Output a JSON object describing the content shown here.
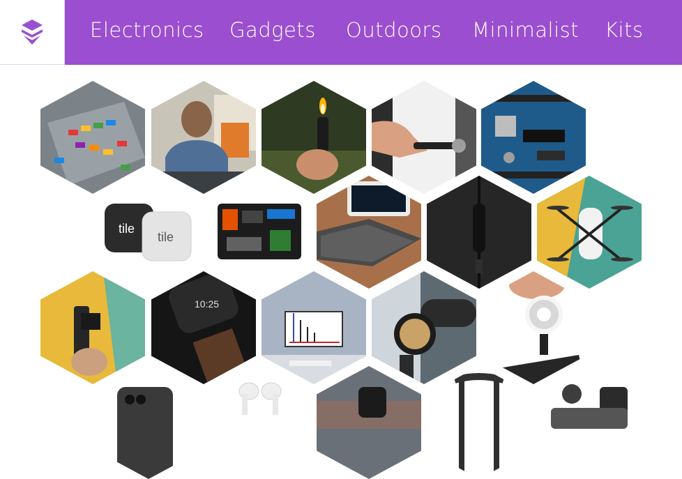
{
  "header": {
    "logo_icon": "layered-stack-icon",
    "brand_color": "#9b4fd0",
    "nav": [
      {
        "label": "Electronics"
      },
      {
        "label": "Gadgets"
      },
      {
        "label": "Outdoors"
      },
      {
        "label": "Minimalist"
      },
      {
        "label": "Kits"
      }
    ]
  },
  "gallery": {
    "tile_text": {
      "tile_front": "tile",
      "tile_back": "tile",
      "watch_time": "10:25"
    },
    "tiles": [
      {
        "name": "lego-building-plate"
      },
      {
        "name": "bus-passenger-headphones"
      },
      {
        "name": "mini-lighter"
      },
      {
        "name": "keychain-flashlight"
      },
      {
        "name": "arduino-board"
      },
      {
        "name": "tile-trackers"
      },
      {
        "name": "cable-organizer"
      },
      {
        "name": "foldable-keyboard"
      },
      {
        "name": "braided-cable"
      },
      {
        "name": "mini-drone"
      },
      {
        "name": "pocket-gimbal-camera"
      },
      {
        "name": "smartwatch-leather-band"
      },
      {
        "name": "desk-monitor"
      },
      {
        "name": "bike-bell"
      },
      {
        "name": "ring-light"
      },
      {
        "name": "smartphone"
      },
      {
        "name": "wireless-earbuds"
      },
      {
        "name": "wrist-smartwatch"
      },
      {
        "name": "braided-lanyard"
      },
      {
        "name": "charging-dock"
      }
    ]
  }
}
